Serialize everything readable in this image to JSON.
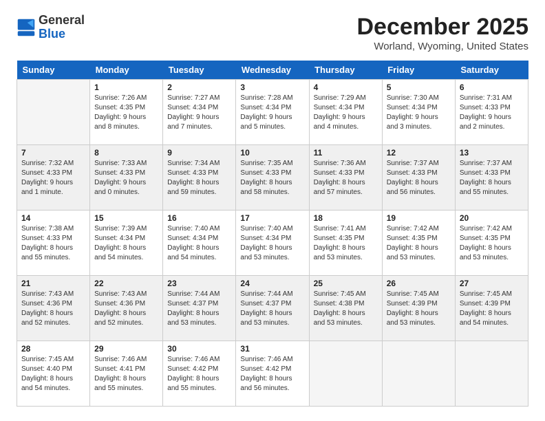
{
  "logo": {
    "general": "General",
    "blue": "Blue"
  },
  "title": {
    "month": "December 2025",
    "location": "Worland, Wyoming, United States"
  },
  "headers": [
    "Sunday",
    "Monday",
    "Tuesday",
    "Wednesday",
    "Thursday",
    "Friday",
    "Saturday"
  ],
  "weeks": [
    [
      {
        "day": "",
        "info": ""
      },
      {
        "day": "1",
        "info": "Sunrise: 7:26 AM\nSunset: 4:35 PM\nDaylight: 9 hours\nand 8 minutes."
      },
      {
        "day": "2",
        "info": "Sunrise: 7:27 AM\nSunset: 4:34 PM\nDaylight: 9 hours\nand 7 minutes."
      },
      {
        "day": "3",
        "info": "Sunrise: 7:28 AM\nSunset: 4:34 PM\nDaylight: 9 hours\nand 5 minutes."
      },
      {
        "day": "4",
        "info": "Sunrise: 7:29 AM\nSunset: 4:34 PM\nDaylight: 9 hours\nand 4 minutes."
      },
      {
        "day": "5",
        "info": "Sunrise: 7:30 AM\nSunset: 4:34 PM\nDaylight: 9 hours\nand 3 minutes."
      },
      {
        "day": "6",
        "info": "Sunrise: 7:31 AM\nSunset: 4:33 PM\nDaylight: 9 hours\nand 2 minutes."
      }
    ],
    [
      {
        "day": "7",
        "info": "Sunrise: 7:32 AM\nSunset: 4:33 PM\nDaylight: 9 hours\nand 1 minute."
      },
      {
        "day": "8",
        "info": "Sunrise: 7:33 AM\nSunset: 4:33 PM\nDaylight: 9 hours\nand 0 minutes."
      },
      {
        "day": "9",
        "info": "Sunrise: 7:34 AM\nSunset: 4:33 PM\nDaylight: 8 hours\nand 59 minutes."
      },
      {
        "day": "10",
        "info": "Sunrise: 7:35 AM\nSunset: 4:33 PM\nDaylight: 8 hours\nand 58 minutes."
      },
      {
        "day": "11",
        "info": "Sunrise: 7:36 AM\nSunset: 4:33 PM\nDaylight: 8 hours\nand 57 minutes."
      },
      {
        "day": "12",
        "info": "Sunrise: 7:37 AM\nSunset: 4:33 PM\nDaylight: 8 hours\nand 56 minutes."
      },
      {
        "day": "13",
        "info": "Sunrise: 7:37 AM\nSunset: 4:33 PM\nDaylight: 8 hours\nand 55 minutes."
      }
    ],
    [
      {
        "day": "14",
        "info": "Sunrise: 7:38 AM\nSunset: 4:33 PM\nDaylight: 8 hours\nand 55 minutes."
      },
      {
        "day": "15",
        "info": "Sunrise: 7:39 AM\nSunset: 4:34 PM\nDaylight: 8 hours\nand 54 minutes."
      },
      {
        "day": "16",
        "info": "Sunrise: 7:40 AM\nSunset: 4:34 PM\nDaylight: 8 hours\nand 54 minutes."
      },
      {
        "day": "17",
        "info": "Sunrise: 7:40 AM\nSunset: 4:34 PM\nDaylight: 8 hours\nand 53 minutes."
      },
      {
        "day": "18",
        "info": "Sunrise: 7:41 AM\nSunset: 4:35 PM\nDaylight: 8 hours\nand 53 minutes."
      },
      {
        "day": "19",
        "info": "Sunrise: 7:42 AM\nSunset: 4:35 PM\nDaylight: 8 hours\nand 53 minutes."
      },
      {
        "day": "20",
        "info": "Sunrise: 7:42 AM\nSunset: 4:35 PM\nDaylight: 8 hours\nand 53 minutes."
      }
    ],
    [
      {
        "day": "21",
        "info": "Sunrise: 7:43 AM\nSunset: 4:36 PM\nDaylight: 8 hours\nand 52 minutes."
      },
      {
        "day": "22",
        "info": "Sunrise: 7:43 AM\nSunset: 4:36 PM\nDaylight: 8 hours\nand 52 minutes."
      },
      {
        "day": "23",
        "info": "Sunrise: 7:44 AM\nSunset: 4:37 PM\nDaylight: 8 hours\nand 53 minutes."
      },
      {
        "day": "24",
        "info": "Sunrise: 7:44 AM\nSunset: 4:37 PM\nDaylight: 8 hours\nand 53 minutes."
      },
      {
        "day": "25",
        "info": "Sunrise: 7:45 AM\nSunset: 4:38 PM\nDaylight: 8 hours\nand 53 minutes."
      },
      {
        "day": "26",
        "info": "Sunrise: 7:45 AM\nSunset: 4:39 PM\nDaylight: 8 hours\nand 53 minutes."
      },
      {
        "day": "27",
        "info": "Sunrise: 7:45 AM\nSunset: 4:39 PM\nDaylight: 8 hours\nand 54 minutes."
      }
    ],
    [
      {
        "day": "28",
        "info": "Sunrise: 7:45 AM\nSunset: 4:40 PM\nDaylight: 8 hours\nand 54 minutes."
      },
      {
        "day": "29",
        "info": "Sunrise: 7:46 AM\nSunset: 4:41 PM\nDaylight: 8 hours\nand 55 minutes."
      },
      {
        "day": "30",
        "info": "Sunrise: 7:46 AM\nSunset: 4:42 PM\nDaylight: 8 hours\nand 55 minutes."
      },
      {
        "day": "31",
        "info": "Sunrise: 7:46 AM\nSunset: 4:42 PM\nDaylight: 8 hours\nand 56 minutes."
      },
      {
        "day": "",
        "info": ""
      },
      {
        "day": "",
        "info": ""
      },
      {
        "day": "",
        "info": ""
      }
    ]
  ]
}
